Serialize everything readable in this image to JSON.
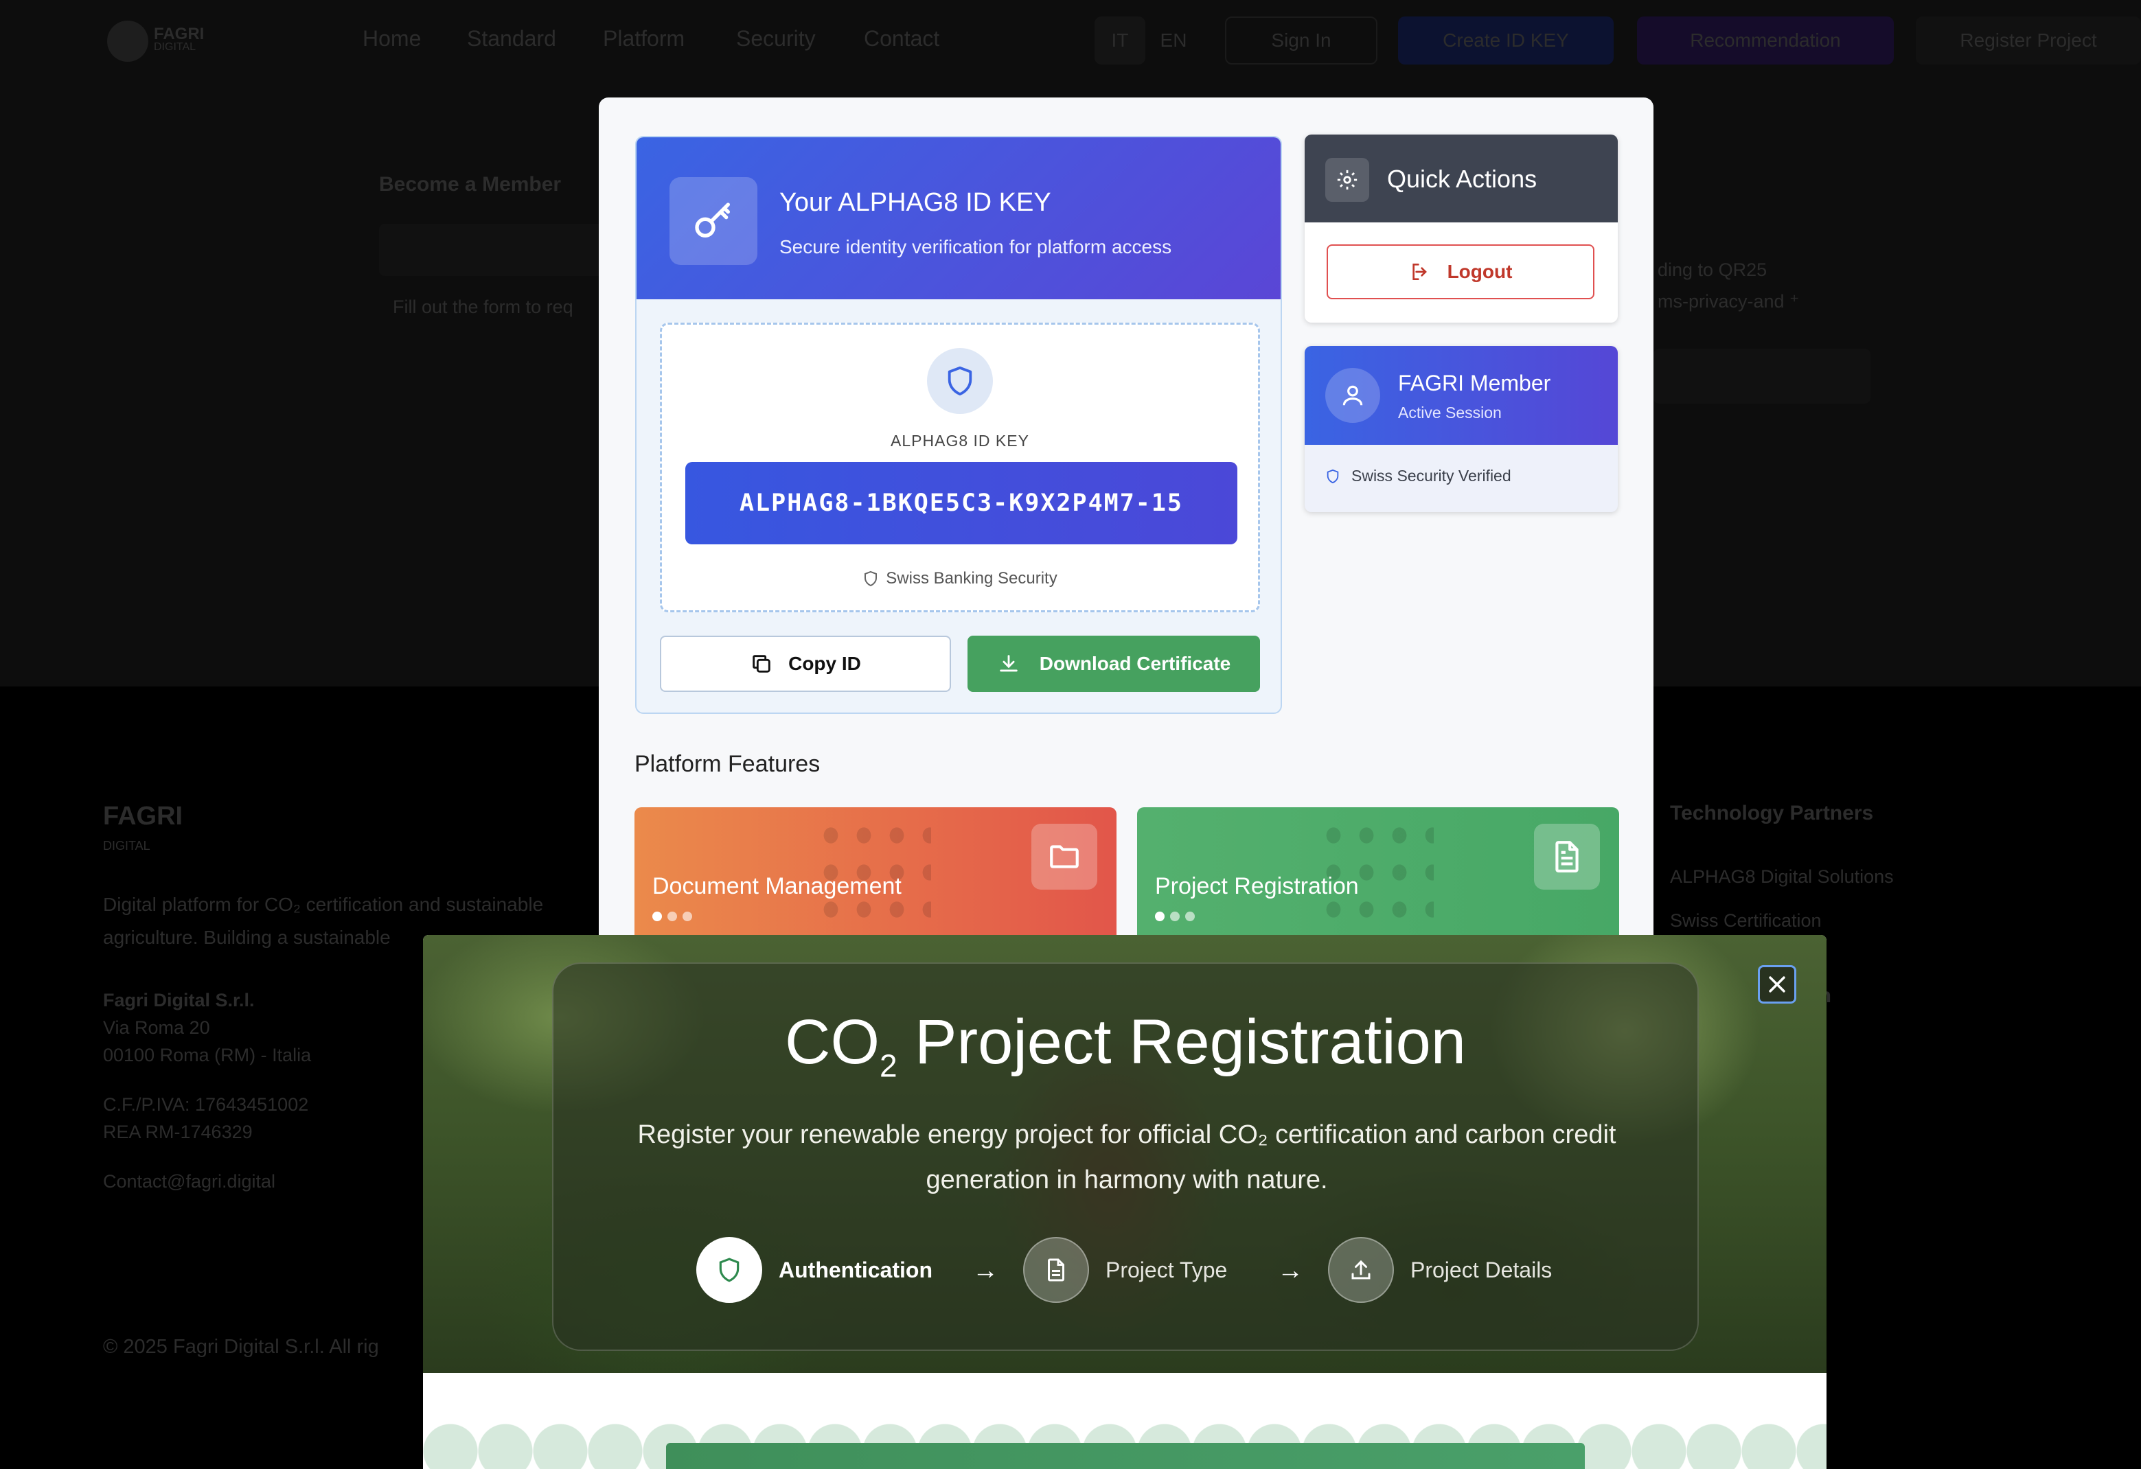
{
  "background": {
    "brand": "FAGRI",
    "brand_sub": "DIGITAL",
    "nav": [
      "Home",
      "Standard",
      "Platform",
      "Security",
      "Contact"
    ],
    "lang": [
      "IT",
      "EN"
    ],
    "actions": [
      "Sign In",
      "Create ID KEY",
      "Recommendation",
      "Register Project"
    ],
    "become_member": "Become a Member",
    "form_hint": "Fill out the form to req",
    "right_text_1": "ding to QR25",
    "right_text_2": "ms-privacy-and ⁺",
    "footer_brand": "FAGRI",
    "footer_brand_sub": "DIGITAL",
    "footer_desc_1": "Digital platform for CO₂ certification and sustainable",
    "footer_desc_2": "agriculture. Building a sustainable",
    "company": "Fagri Digital S.r.l.",
    "address_1": "Via Roma 20",
    "address_2": "00100 Roma (RM) - Italia",
    "vat": "C.F./P.IVA: 17643451002",
    "rea": "REA RM-1746329",
    "contact": "Contact@fagri.digital",
    "tech_partners": "Technology Partners",
    "partner_1": "ALPHAG8 Digital Solutions",
    "partner_2": "Swiss Certification",
    "col_heading": "tion",
    "copyright": "© 2025 Fagri Digital S.r.l. All rig"
  },
  "id_card": {
    "title": "Your ALPHAG8 ID KEY",
    "subtitle": "Secure identity verification for platform access",
    "label": "ALPHAG8 ID KEY",
    "value": "ALPHAG8-1BKQE5C3-K9X2P4M7-15",
    "security_note": "Swiss Banking Security",
    "copy_label": "Copy ID",
    "download_label": "Download Certificate"
  },
  "quick_actions": {
    "title": "Quick Actions",
    "logout_label": "Logout"
  },
  "member": {
    "name": "FAGRI Member",
    "status": "Active Session",
    "verified": "Swiss Security Verified"
  },
  "features": {
    "title": "Platform Features",
    "items": [
      "Document Management",
      "Project Registration"
    ]
  },
  "registration": {
    "title_prefix": "CO",
    "title_sub": "2",
    "title_rest": " Project Registration",
    "description": "Register your renewable energy project for official CO₂ certification and carbon credit generation in harmony with nature.",
    "steps": [
      "Authentication",
      "Project Type",
      "Project Details"
    ],
    "active_step": 0
  },
  "colors": {
    "accent_blue": "#3a64e3",
    "success_green": "#46a15f",
    "danger_red": "#e05050",
    "feature_orange": "#eb8a4b"
  }
}
